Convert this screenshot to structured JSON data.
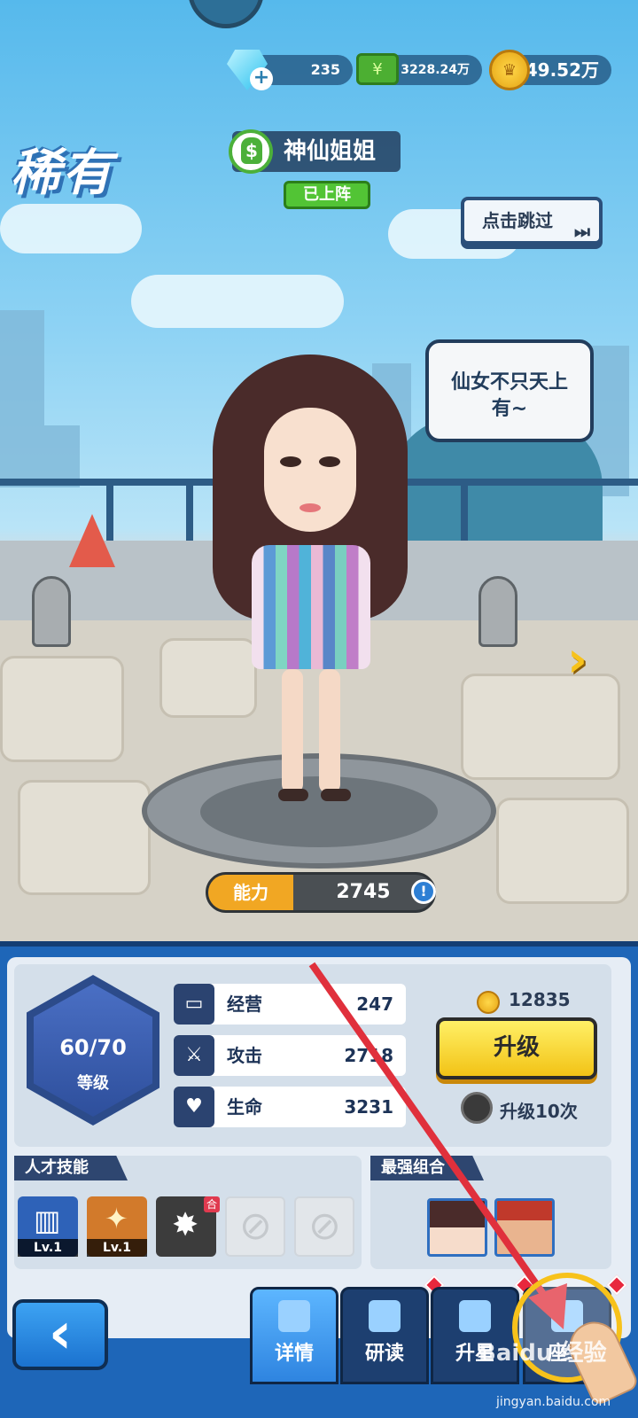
{
  "resources": {
    "gems": "235",
    "cash": "3228.24万",
    "coins": "49.52万"
  },
  "character": {
    "rarity": "稀有",
    "name": "神仙姐姐",
    "status": "已上阵",
    "speech": "仙女不只天上有~",
    "power_label": "能力",
    "power_value": "2745"
  },
  "skip_button": "点击跳过",
  "level": {
    "value": "60/70",
    "caption": "等级"
  },
  "stats": [
    {
      "label": "经营",
      "value": "247",
      "icon": "book-icon"
    },
    {
      "label": "攻击",
      "value": "2718",
      "icon": "sword-icon"
    },
    {
      "label": "生命",
      "value": "3231",
      "icon": "heart-icon"
    }
  ],
  "upgrade": {
    "cost": "12835",
    "button_label": "升级",
    "toggle_label": "升级10次"
  },
  "skills": {
    "title": "人才技能",
    "items": [
      {
        "level": "Lv.1",
        "icon": "chart-skill-icon"
      },
      {
        "level": "Lv.1",
        "icon": "fire-skill-icon"
      },
      {
        "level": "",
        "icon": "flash-skill-icon",
        "badge": "合"
      }
    ]
  },
  "combo": {
    "title": "最强组合"
  },
  "nav": {
    "tabs": [
      "详情",
      "研读",
      "升星",
      "座驾"
    ]
  },
  "watermark": {
    "brand": "Baidu 经验",
    "url": "jingyan.baidu.com"
  },
  "colors": {
    "accent": "#1e66b8",
    "upgrade": "#f2c316",
    "status": "#52c435",
    "highlight": "#f7c21b"
  }
}
